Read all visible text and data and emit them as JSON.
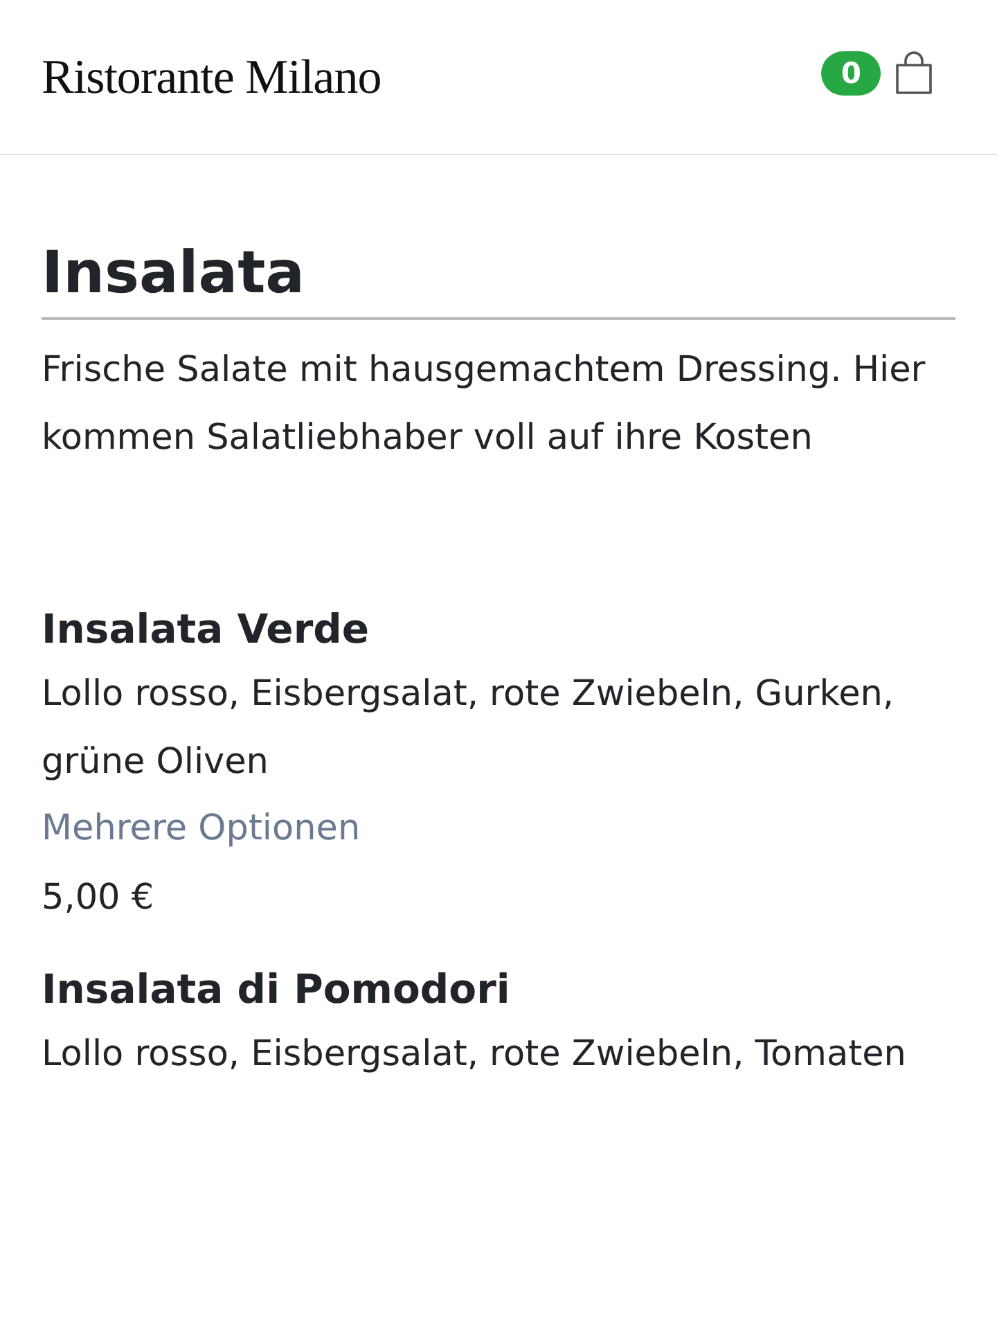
{
  "header": {
    "logo": "Ristorante Milano",
    "cart_count": "0"
  },
  "category": {
    "title": "Insalata",
    "description": "Frische Salate mit hausgemachtem Dressing. Hier kommen Salatliebhaber voll auf ihre Kosten"
  },
  "items": [
    {
      "name": "Insalata Verde",
      "description": "Lollo rosso, Eisbergsalat, rote Zwiebeln, Gurken, grüne Oliven",
      "options_link": "Mehrere Optionen",
      "price": "5,00 €"
    },
    {
      "name": "Insalata di Pomodori",
      "description": "Lollo rosso, Eisbergsalat, rote Zwiebeln, Tomaten"
    }
  ]
}
